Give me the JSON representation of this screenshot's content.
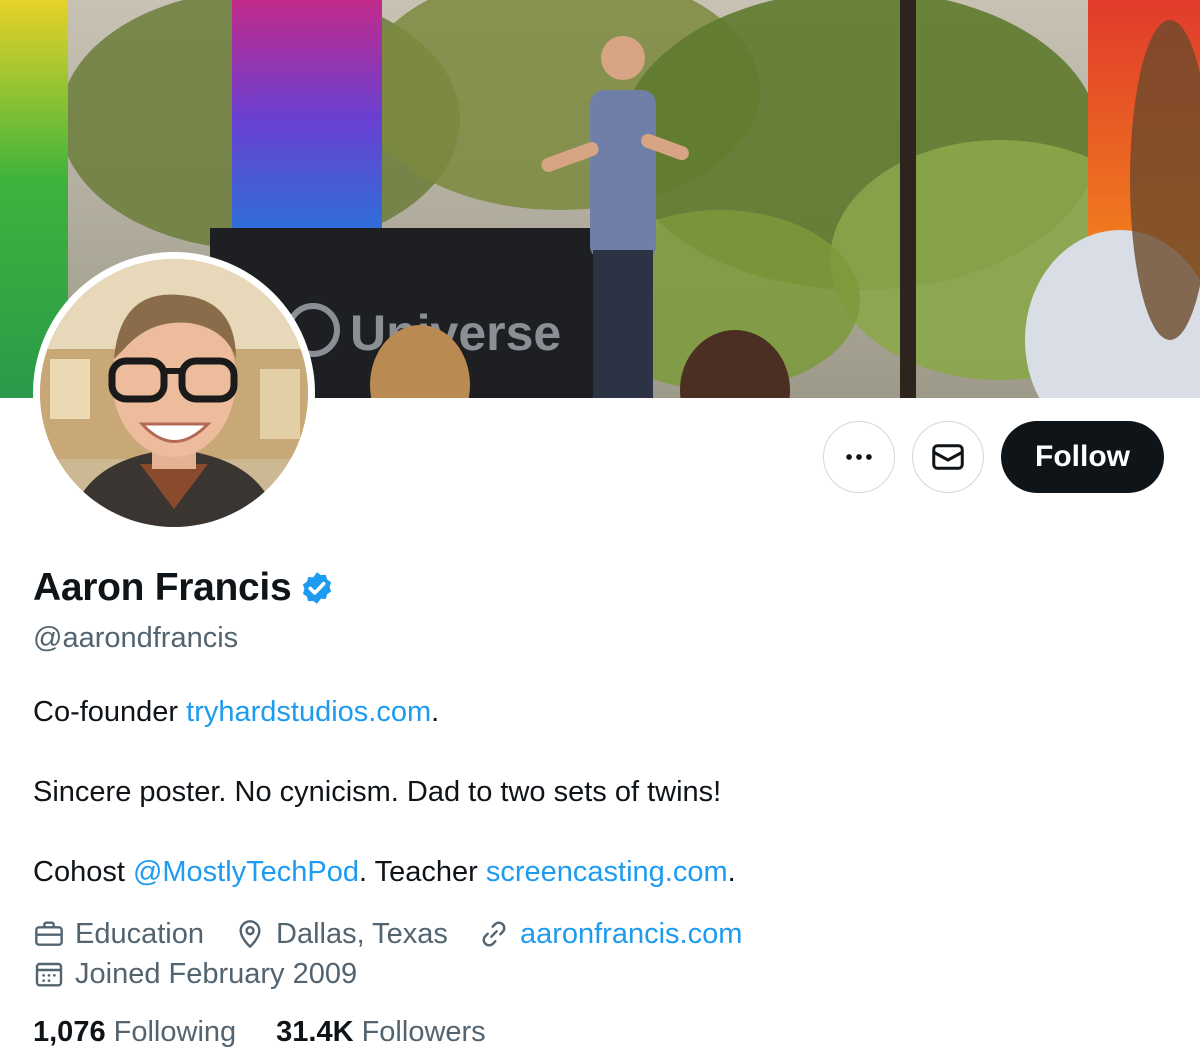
{
  "banner": {
    "sign_text": "Universe",
    "alt": "Header photo"
  },
  "profile": {
    "name": "Aaron Francis",
    "handle": "@aarondfrancis",
    "verified": true,
    "verified_color": "#1d9bf0"
  },
  "actions": {
    "more_icon": "more-horizontal-icon",
    "message_icon": "envelope-icon",
    "follow_label": "Follow"
  },
  "bio": {
    "line1_prefix": "Co-founder ",
    "line1_link": "tryhardstudios.com",
    "line1_suffix": ".",
    "line2": "Sincere poster. No cynicism. Dad to two sets of twins!",
    "line3_prefix": "Cohost ",
    "line3_mention": "@MostlyTechPod",
    "line3_middle": ". Teacher ",
    "line3_link": "screencasting.com",
    "line3_suffix": "."
  },
  "meta": {
    "category": "Education",
    "location": "Dallas, Texas",
    "website": "aaronfrancis.com",
    "joined": "Joined February 2009"
  },
  "stats": {
    "following_count": "1,076",
    "following_label": "Following",
    "followers_count": "31.4K",
    "followers_label": "Followers"
  },
  "colors": {
    "link": "#1d9bf0",
    "text_primary": "#0f1419",
    "text_secondary": "#536471",
    "follow_bg": "#0f1419"
  }
}
